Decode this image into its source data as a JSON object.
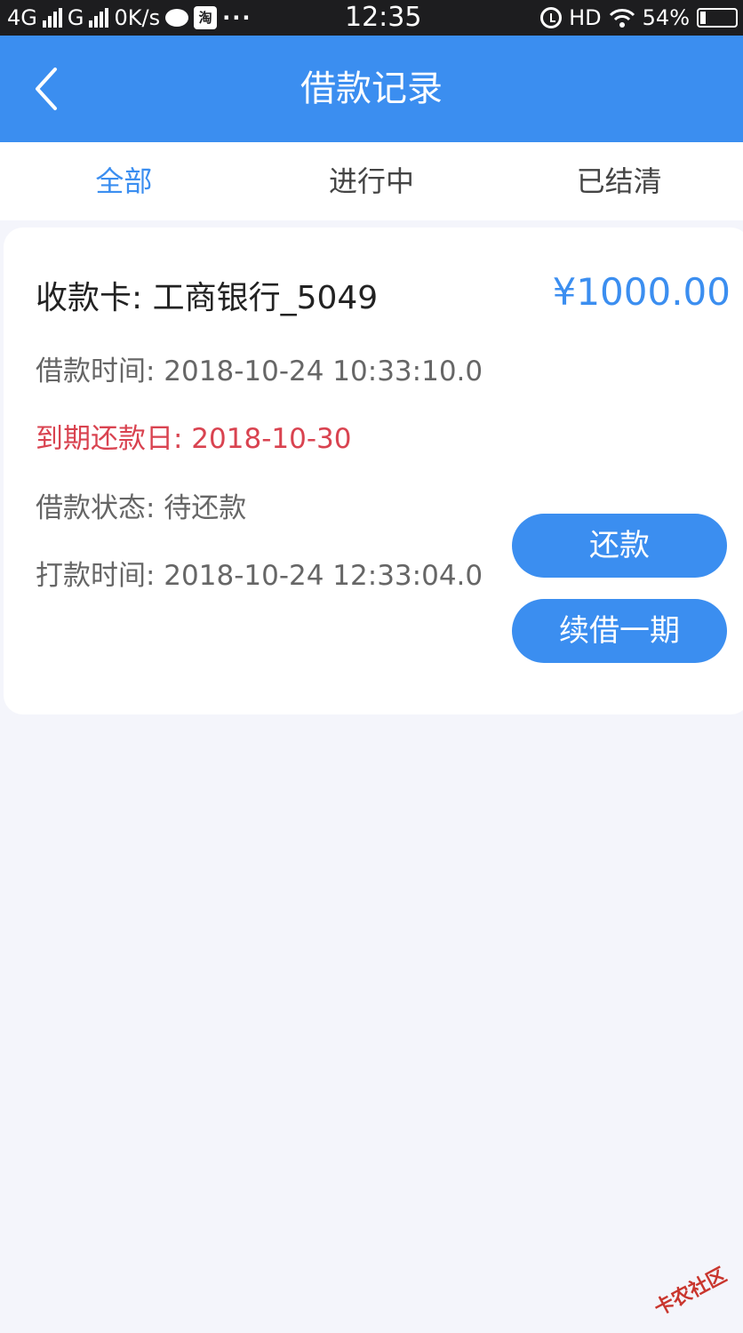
{
  "status_bar": {
    "network1": "4G",
    "network2": "G",
    "speed": "0K/s",
    "taobao_badge": "淘",
    "more": "···",
    "time": "12:35",
    "hd": "HD",
    "battery": "54%",
    "icons": [
      "signal-icon",
      "message-bubble-icon",
      "taobao-icon",
      "alarm-icon",
      "wifi-icon",
      "battery-icon"
    ]
  },
  "nav": {
    "title": "借款记录",
    "back_icon": "chevron-left-icon"
  },
  "tabs": [
    {
      "label": "全部",
      "active": true
    },
    {
      "label": "进行中",
      "active": false
    },
    {
      "label": "已结清",
      "active": false
    }
  ],
  "loan": {
    "bank": "收款卡: 工商银行_5049",
    "amount": "¥1000.00",
    "loan_time": "借款时间: 2018-10-24 10:33:10.0",
    "due_date": "到期还款日: 2018-10-30",
    "status": "借款状态: 待还款",
    "paid_time": "打款时间: 2018-10-24 12:33:04.0",
    "repay_button": "还款",
    "renew_button": "续借一期"
  },
  "watermark": "卡农社区",
  "colors": {
    "primary": "#3b8ef0",
    "due": "#d94350",
    "status_bar": "#1d1d1f",
    "background": "#f4f5fb"
  }
}
